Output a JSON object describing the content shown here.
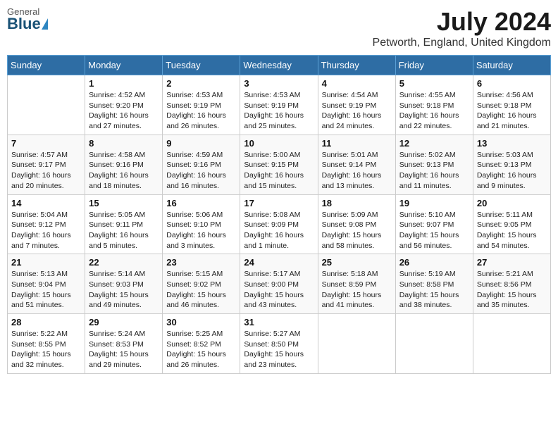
{
  "header": {
    "logo_top": "General",
    "logo_bottom": "Blue",
    "title": "July 2024",
    "subtitle": "Petworth, England, United Kingdom"
  },
  "calendar": {
    "days_of_week": [
      "Sunday",
      "Monday",
      "Tuesday",
      "Wednesday",
      "Thursday",
      "Friday",
      "Saturday"
    ],
    "weeks": [
      [
        {
          "day": "",
          "info": ""
        },
        {
          "day": "1",
          "info": "Sunrise: 4:52 AM\nSunset: 9:20 PM\nDaylight: 16 hours\nand 27 minutes."
        },
        {
          "day": "2",
          "info": "Sunrise: 4:53 AM\nSunset: 9:19 PM\nDaylight: 16 hours\nand 26 minutes."
        },
        {
          "day": "3",
          "info": "Sunrise: 4:53 AM\nSunset: 9:19 PM\nDaylight: 16 hours\nand 25 minutes."
        },
        {
          "day": "4",
          "info": "Sunrise: 4:54 AM\nSunset: 9:19 PM\nDaylight: 16 hours\nand 24 minutes."
        },
        {
          "day": "5",
          "info": "Sunrise: 4:55 AM\nSunset: 9:18 PM\nDaylight: 16 hours\nand 22 minutes."
        },
        {
          "day": "6",
          "info": "Sunrise: 4:56 AM\nSunset: 9:18 PM\nDaylight: 16 hours\nand 21 minutes."
        }
      ],
      [
        {
          "day": "7",
          "info": "Sunrise: 4:57 AM\nSunset: 9:17 PM\nDaylight: 16 hours\nand 20 minutes."
        },
        {
          "day": "8",
          "info": "Sunrise: 4:58 AM\nSunset: 9:16 PM\nDaylight: 16 hours\nand 18 minutes."
        },
        {
          "day": "9",
          "info": "Sunrise: 4:59 AM\nSunset: 9:16 PM\nDaylight: 16 hours\nand 16 minutes."
        },
        {
          "day": "10",
          "info": "Sunrise: 5:00 AM\nSunset: 9:15 PM\nDaylight: 16 hours\nand 15 minutes."
        },
        {
          "day": "11",
          "info": "Sunrise: 5:01 AM\nSunset: 9:14 PM\nDaylight: 16 hours\nand 13 minutes."
        },
        {
          "day": "12",
          "info": "Sunrise: 5:02 AM\nSunset: 9:13 PM\nDaylight: 16 hours\nand 11 minutes."
        },
        {
          "day": "13",
          "info": "Sunrise: 5:03 AM\nSunset: 9:13 PM\nDaylight: 16 hours\nand 9 minutes."
        }
      ],
      [
        {
          "day": "14",
          "info": "Sunrise: 5:04 AM\nSunset: 9:12 PM\nDaylight: 16 hours\nand 7 minutes."
        },
        {
          "day": "15",
          "info": "Sunrise: 5:05 AM\nSunset: 9:11 PM\nDaylight: 16 hours\nand 5 minutes."
        },
        {
          "day": "16",
          "info": "Sunrise: 5:06 AM\nSunset: 9:10 PM\nDaylight: 16 hours\nand 3 minutes."
        },
        {
          "day": "17",
          "info": "Sunrise: 5:08 AM\nSunset: 9:09 PM\nDaylight: 16 hours\nand 1 minute."
        },
        {
          "day": "18",
          "info": "Sunrise: 5:09 AM\nSunset: 9:08 PM\nDaylight: 15 hours\nand 58 minutes."
        },
        {
          "day": "19",
          "info": "Sunrise: 5:10 AM\nSunset: 9:07 PM\nDaylight: 15 hours\nand 56 minutes."
        },
        {
          "day": "20",
          "info": "Sunrise: 5:11 AM\nSunset: 9:05 PM\nDaylight: 15 hours\nand 54 minutes."
        }
      ],
      [
        {
          "day": "21",
          "info": "Sunrise: 5:13 AM\nSunset: 9:04 PM\nDaylight: 15 hours\nand 51 minutes."
        },
        {
          "day": "22",
          "info": "Sunrise: 5:14 AM\nSunset: 9:03 PM\nDaylight: 15 hours\nand 49 minutes."
        },
        {
          "day": "23",
          "info": "Sunrise: 5:15 AM\nSunset: 9:02 PM\nDaylight: 15 hours\nand 46 minutes."
        },
        {
          "day": "24",
          "info": "Sunrise: 5:17 AM\nSunset: 9:00 PM\nDaylight: 15 hours\nand 43 minutes."
        },
        {
          "day": "25",
          "info": "Sunrise: 5:18 AM\nSunset: 8:59 PM\nDaylight: 15 hours\nand 41 minutes."
        },
        {
          "day": "26",
          "info": "Sunrise: 5:19 AM\nSunset: 8:58 PM\nDaylight: 15 hours\nand 38 minutes."
        },
        {
          "day": "27",
          "info": "Sunrise: 5:21 AM\nSunset: 8:56 PM\nDaylight: 15 hours\nand 35 minutes."
        }
      ],
      [
        {
          "day": "28",
          "info": "Sunrise: 5:22 AM\nSunset: 8:55 PM\nDaylight: 15 hours\nand 32 minutes."
        },
        {
          "day": "29",
          "info": "Sunrise: 5:24 AM\nSunset: 8:53 PM\nDaylight: 15 hours\nand 29 minutes."
        },
        {
          "day": "30",
          "info": "Sunrise: 5:25 AM\nSunset: 8:52 PM\nDaylight: 15 hours\nand 26 minutes."
        },
        {
          "day": "31",
          "info": "Sunrise: 5:27 AM\nSunset: 8:50 PM\nDaylight: 15 hours\nand 23 minutes."
        },
        {
          "day": "",
          "info": ""
        },
        {
          "day": "",
          "info": ""
        },
        {
          "day": "",
          "info": ""
        }
      ]
    ]
  }
}
